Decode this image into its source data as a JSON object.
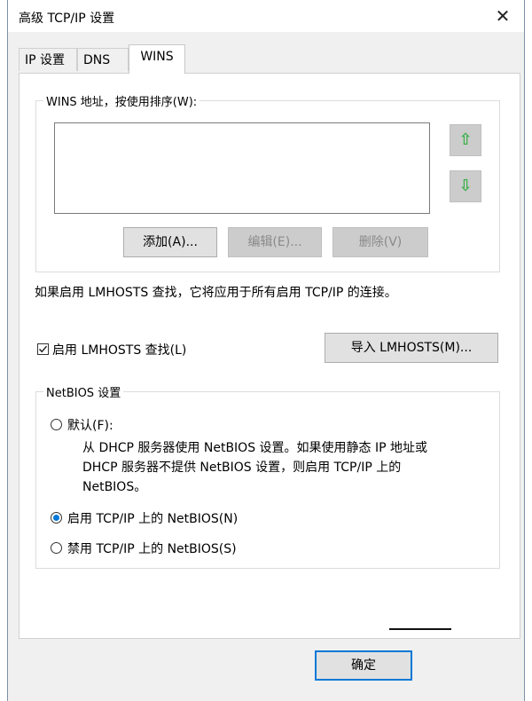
{
  "window": {
    "title": "高级 TCP/IP 设置",
    "close_glyph": "✕"
  },
  "tabs": [
    {
      "label": "IP 设置"
    },
    {
      "label": "DNS"
    },
    {
      "label": "WINS"
    }
  ],
  "wins": {
    "group_label": "WINS 地址，按使用排序(W):",
    "up_glyph": "⇧",
    "down_glyph": "⇩",
    "add_label": "添加(A)...",
    "edit_label": "编辑(E)...",
    "remove_label": "删除(V)"
  },
  "lmhosts": {
    "info": "如果启用 LMHOSTS 查找，它将应用于所有启用 TCP/IP 的连接。",
    "checkbox_label": "启用 LMHOSTS 查找(L)",
    "checked": true,
    "import_label": "导入 LMHOSTS(M)..."
  },
  "netbios": {
    "group_label": "NetBIOS 设置",
    "default_label": "默认(F):",
    "default_desc_1": "从 DHCP 服务器使用 NetBIOS 设置。如果使用静态 IP 地址或",
    "default_desc_2": "DHCP 服务器不提供 NetBIOS 设置，则启用 TCP/IP 上的",
    "default_desc_3": "NetBIOS。",
    "enable_label": "启用 TCP/IP 上的 NetBIOS(N)",
    "disable_label": "禁用 TCP/IP 上的 NetBIOS(S)",
    "selected": "enable"
  },
  "footer": {
    "ok_label": "确定"
  },
  "colors": {
    "accent": "#0078d7",
    "arrow": "#3cb04a"
  }
}
